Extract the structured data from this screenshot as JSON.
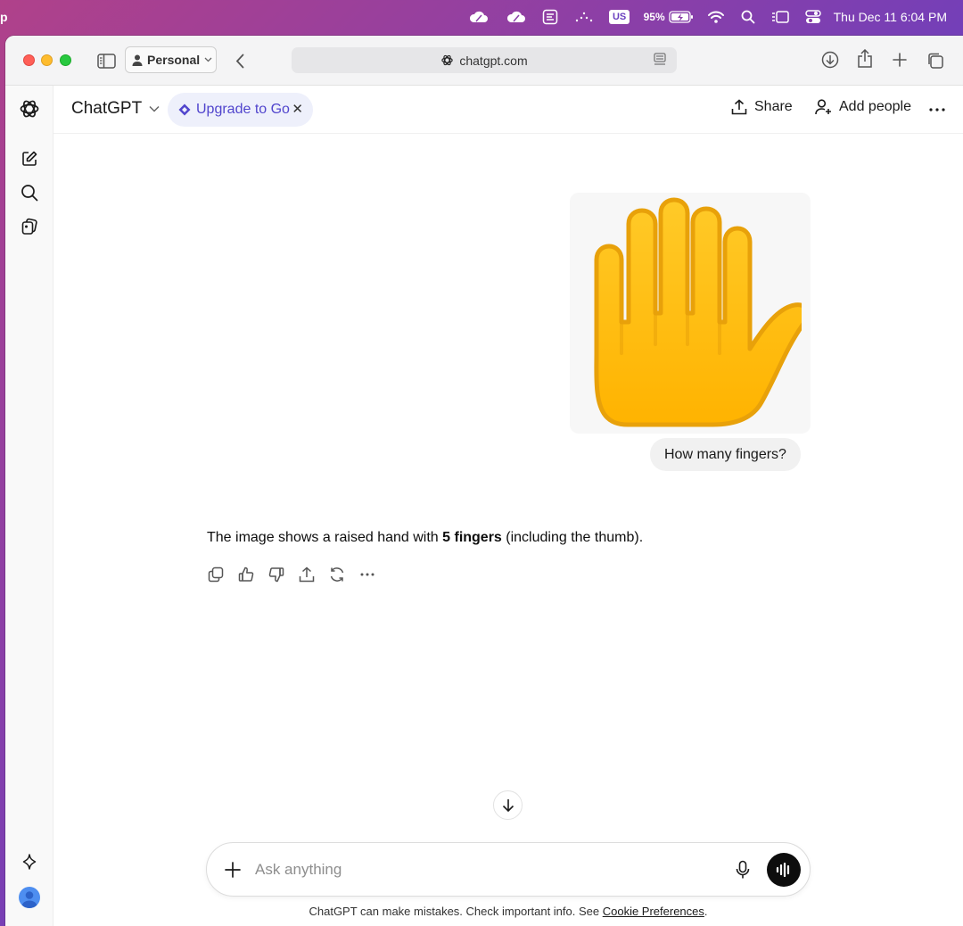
{
  "menubar": {
    "app_fragment": "p",
    "keyboard_layout": "US",
    "battery_percent": "95%",
    "datetime": "Thu Dec 11  6:04 PM",
    "icons": [
      "cloud-icon",
      "cloud-icon",
      "text-input-icon",
      "dots-icon",
      "battery-icon",
      "wifi-icon",
      "search-icon",
      "display-icon",
      "control-center-icon"
    ]
  },
  "browser": {
    "profile_label": "Personal",
    "url": "chatgpt.com"
  },
  "chat": {
    "model_label": "ChatGPT",
    "upgrade_label": "Upgrade to Go",
    "share_label": "Share",
    "add_people_label": "Add people",
    "user_message": "How many fingers?",
    "assistant_prefix": "The image shows a raised hand with ",
    "assistant_bold": "5 fingers",
    "assistant_suffix": " (including the thumb).",
    "composer_placeholder": "Ask anything",
    "disclaimer_text": "ChatGPT can make mistakes. Check important info. See ",
    "disclaimer_link": "Cookie Preferences",
    "disclaimer_end": "."
  },
  "colors": {
    "accent_purple": "#5145cd",
    "hand_yellow": "#ffc83d",
    "hand_outline": "#e8a10a"
  }
}
